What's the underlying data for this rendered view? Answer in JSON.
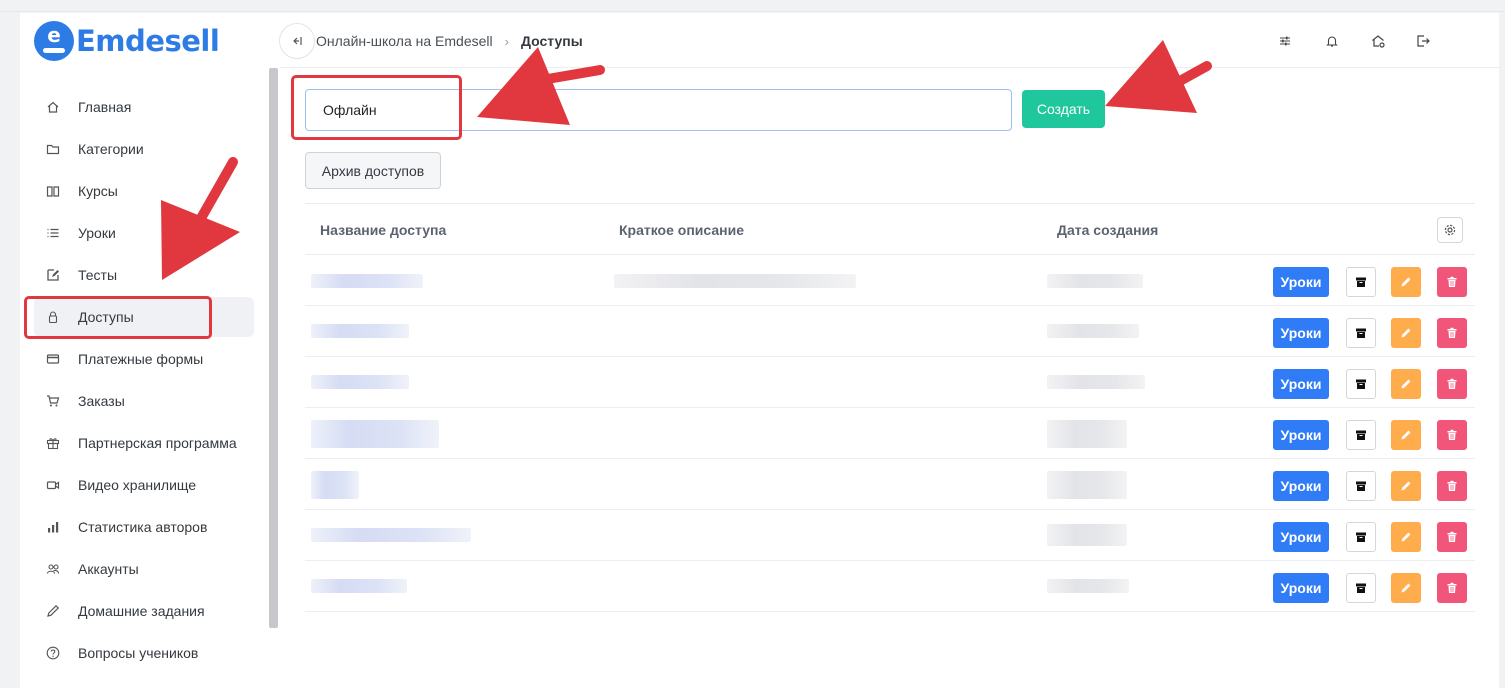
{
  "app": {
    "logo_text": "Emdesell",
    "logo_letter": "e",
    "brand_color": "#2d7be5"
  },
  "sidebar": {
    "items": [
      {
        "label": "Главная",
        "icon": "home-icon",
        "active": false
      },
      {
        "label": "Категории",
        "icon": "folder-icon",
        "active": false
      },
      {
        "label": "Курсы",
        "icon": "book-icon",
        "active": false
      },
      {
        "label": "Уроки",
        "icon": "list-icon",
        "active": false
      },
      {
        "label": "Тесты",
        "icon": "edit-icon",
        "active": false
      },
      {
        "label": "Доступы",
        "icon": "lock-icon",
        "active": true
      },
      {
        "label": "Платежные формы",
        "icon": "card-icon",
        "active": false
      },
      {
        "label": "Заказы",
        "icon": "cart-icon",
        "active": false
      },
      {
        "label": "Партнерская программа",
        "icon": "gift-icon",
        "active": false
      },
      {
        "label": "Видео хранилище",
        "icon": "video-icon",
        "active": false
      },
      {
        "label": "Статистика авторов",
        "icon": "bar-chart-icon",
        "active": false
      },
      {
        "label": "Аккаунты",
        "icon": "users-icon",
        "active": false
      },
      {
        "label": "Домашние задания",
        "icon": "pencil-icon",
        "active": false
      },
      {
        "label": "Вопросы учеников",
        "icon": "question-icon",
        "active": false
      }
    ]
  },
  "header": {
    "collapse_icon": "collapse-left-icon",
    "breadcrumb": {
      "root": "Онлайн-школа на Emdesell",
      "current": "Доступы"
    },
    "icons": [
      "sliders-icon",
      "bell-icon",
      "home-settings-icon",
      "logout-icon"
    ]
  },
  "form": {
    "input_value": "Офлайн",
    "create_label": "Создать",
    "create_color": "#1ec79c",
    "archive_label": "Архив доступов"
  },
  "table": {
    "headers": [
      "Название доступа",
      "Краткое описание",
      "Дата создания"
    ],
    "row_count": 7,
    "actions": {
      "lessons_label": "Уроки",
      "lessons_color": "#2f7cf6",
      "edit_color": "#ffac4d",
      "delete_color": "#f2557a"
    }
  },
  "annotations": {
    "highlight_color": "#e0383e"
  }
}
